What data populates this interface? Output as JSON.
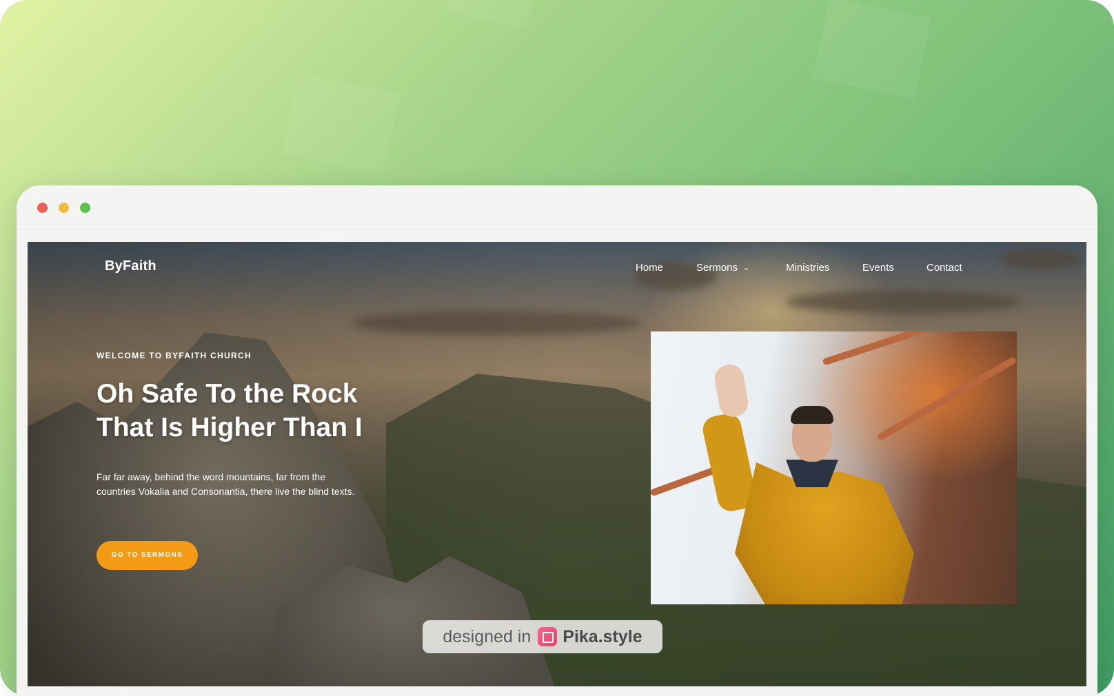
{
  "site": {
    "logo": "ByFaith",
    "nav": {
      "home": "Home",
      "sermons": "Sermons",
      "ministries": "Ministries",
      "events": "Events",
      "contact": "Contact"
    }
  },
  "hero": {
    "eyebrow": "WELCOME TO BYFAITH CHURCH",
    "headline_line1": "Oh Safe To the Rock",
    "headline_line2": "That Is Higher Than I",
    "body": "Far far away, behind the word mountains, far from the countries Vokalia and Consonantia, there live the blind texts.",
    "cta_label": "GO TO SERMONS"
  },
  "watermark": {
    "prefix": "designed in",
    "brand": "Pika.style"
  },
  "colors": {
    "accent": "#f49a17",
    "window_red": "#ec5f57",
    "window_yellow": "#f2bb40",
    "window_green": "#5fc150"
  },
  "icons": {
    "nav_dropdown": "chevron-down-icon",
    "watermark_logo": "pika-crop-icon"
  }
}
